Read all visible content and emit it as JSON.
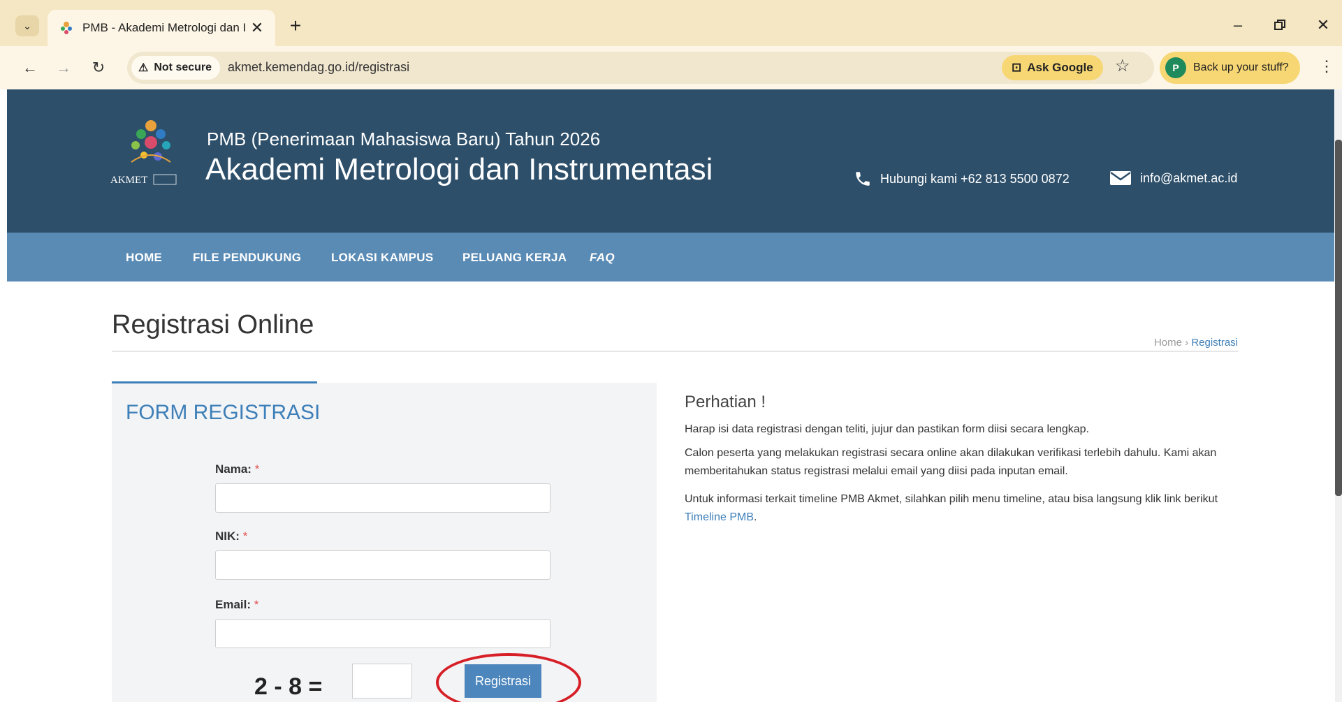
{
  "browser": {
    "tab_title": "PMB - Akademi Metrologi dan I",
    "tab_close": "✕",
    "new_tab": "+",
    "not_secure_label": "Not secure",
    "url": "akmet.kemendag.go.id/registrasi",
    "ask_google": "Ask Google",
    "backup_label": "Back up your stuff?",
    "avatar_letter": "P",
    "accent_color": "#f7d774"
  },
  "header": {
    "logo_text": "AKMET",
    "subtitle": "PMB (Penerimaan Mahasiswa Baru) Tahun 2026",
    "title": "Akademi Metrologi dan Instrumentasi",
    "phone": "Hubungi kami +62 813 5500 0872",
    "email": "info@akmet.ac.id"
  },
  "nav": {
    "items": [
      "HOME",
      "FILE PENDUKUNG",
      "LOKASI KAMPUS",
      "PELUANG KERJA",
      "FAQ"
    ]
  },
  "page": {
    "title": "Registrasi Online",
    "breadcrumb_home": "Home",
    "breadcrumb_sep": "›",
    "breadcrumb_current": "Registrasi"
  },
  "form": {
    "heading": "FORM REGISTRASI",
    "required_mark": "*",
    "fields": [
      {
        "label": "Nama:",
        "value": ""
      },
      {
        "label": "NIK:",
        "value": ""
      },
      {
        "label": "Email:",
        "value": ""
      }
    ],
    "captcha_question": "2 - 8 =",
    "captcha_value": "",
    "submit_label": "Registrasi"
  },
  "notice": {
    "title": "Perhatian !",
    "p1": "Harap isi data registrasi dengan teliti, jujur dan pastikan form diisi secara lengkap.",
    "p2": "Calon peserta yang melakukan registrasi secara online akan dilakukan verifikasi terlebih dahulu. Kami akan memberitahukan status registrasi melalui email yang diisi pada inputan email.",
    "p3_prefix": "Untuk informasi terkait timeline PMB Akmet, silahkan pilih menu timeline, atau bisa langsung klik link berikut",
    "p3_link": "Timeline PMB",
    "p3_suffix": "."
  },
  "colors": {
    "header_bg": "#2d4f6a",
    "nav_bg": "#5a8bb5",
    "link": "#3d7fb8",
    "highlight": "#d61f26"
  }
}
